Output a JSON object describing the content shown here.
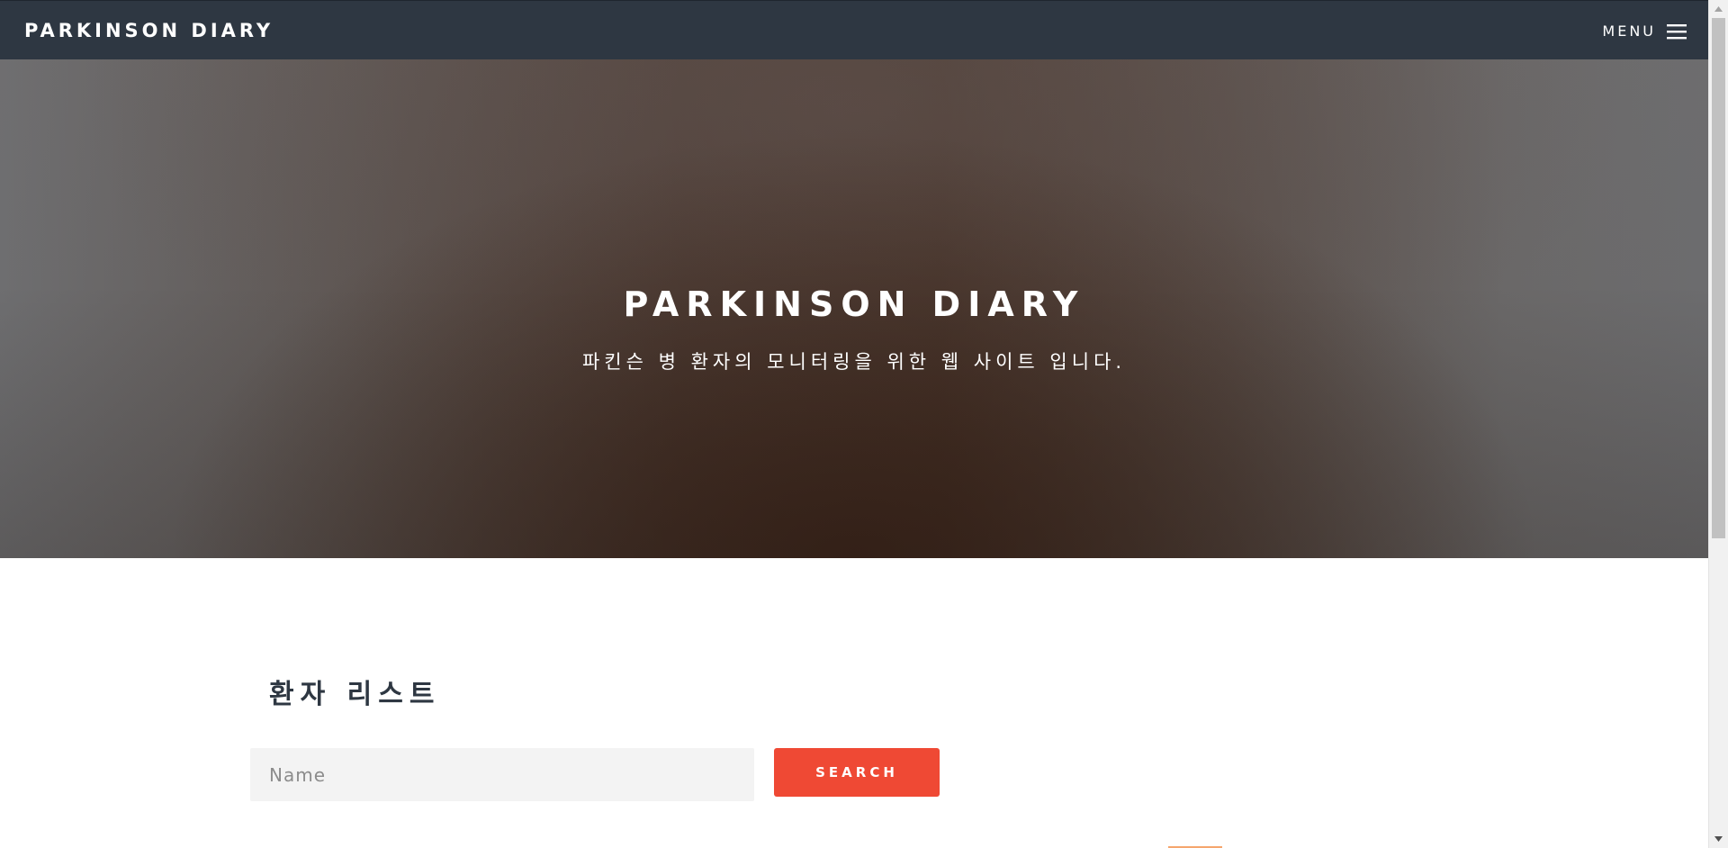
{
  "navbar": {
    "brand": "PARKINSON DIARY",
    "menu_label": "MENU",
    "menu_icon": "hamburger-menu-icon"
  },
  "hero": {
    "title": "PARKINSON DIARY",
    "subtitle": "파킨슨 병 환자의 모니터링을 위한 웹 사이트 입니다."
  },
  "patients": {
    "title": "환자 리스트",
    "search": {
      "placeholder": "Name",
      "value": "",
      "button_label": "SEARCH"
    }
  },
  "colors": {
    "navbar_bg": "#2e3742",
    "accent": "#ef4934",
    "input_bg": "#f3f3f3",
    "heading": "#2e3742"
  },
  "scrollbar": {
    "up_icon": "scroll-up-arrow-icon",
    "down_icon": "scroll-down-arrow-icon"
  }
}
